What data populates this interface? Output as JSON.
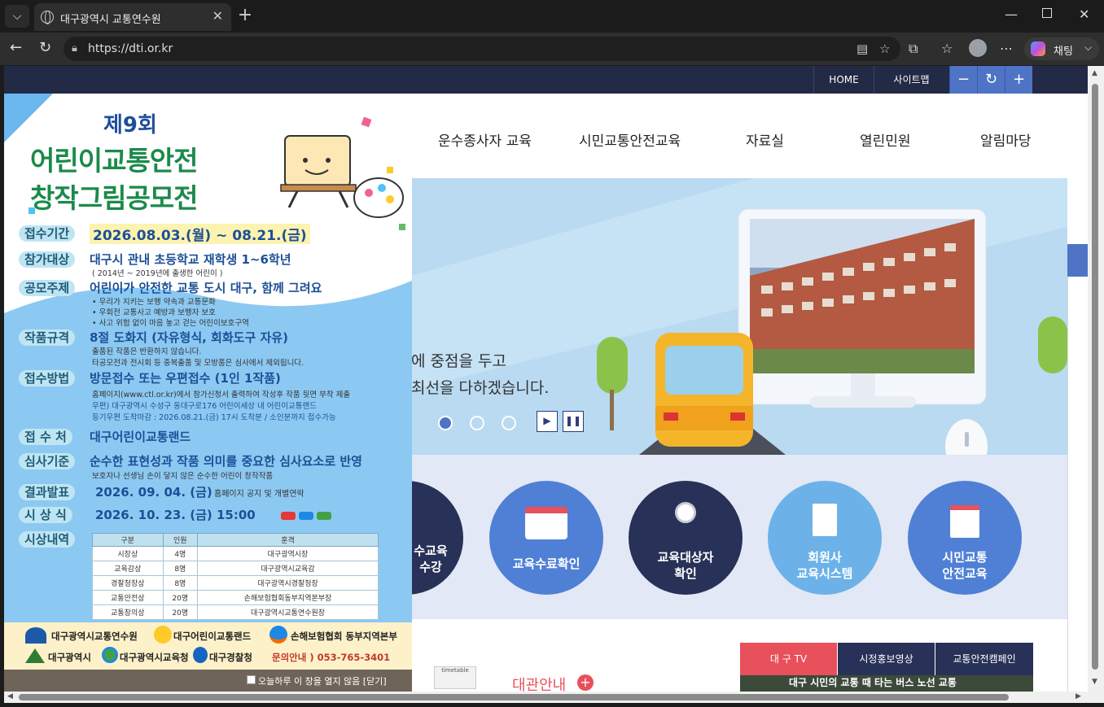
{
  "browser": {
    "tab_title": "대구광역시 교통연수원",
    "url": "https://dti.or.kr",
    "chat_label": "채팅",
    "icons": [
      "tab-list-icon",
      "globe-icon",
      "close-icon",
      "new-tab-icon",
      "minimize-icon",
      "maximize-icon",
      "window-close-icon",
      "back-icon",
      "refresh-icon",
      "lock-icon",
      "reader-icon",
      "favorite-star-icon",
      "extensions-icon",
      "favorites-icon",
      "profile-icon",
      "more-icon",
      "copilot-icon"
    ]
  },
  "topbar": {
    "home": "HOME",
    "sitemap": "사이트맵",
    "zoom_out": "−",
    "reset": "↻",
    "zoom_in": "+"
  },
  "main_nav": [
    "운수종사자 교육",
    "시민교통안전교육",
    "자료실",
    "열린민원",
    "알림마당"
  ],
  "hero": {
    "line1": "에 중점을 두고",
    "line2": "최선을 다하겠습니다.",
    "play": "▶",
    "pause": "❚❚"
  },
  "quick_links": [
    {
      "label1": "수교육",
      "label2": "수강"
    },
    {
      "label1": "교육수료확인",
      "label2": ""
    },
    {
      "label1": "교육대상자",
      "label2": "확인"
    },
    {
      "label1": "회원사",
      "label2": "교육시스템"
    },
    {
      "label1": "시민교통",
      "label2": "안전교육"
    }
  ],
  "guide": {
    "title": "대관안내",
    "badge": "timetable"
  },
  "tv_tabs": [
    "대 구  TV",
    "시정홍보영상",
    "교통안전캠페인"
  ],
  "tv_thumb_caption": "대구 시민의 교통 때 타는 버스 노선 교통",
  "popup": {
    "edition": "제9회",
    "title1": "어린이교통안전",
    "title2": "창작그림공모전",
    "rows": [
      {
        "label": "접수기간",
        "value": "2026.08.03.(월) ~ 08.21.(금)"
      },
      {
        "label": "참가대상",
        "value": "대구시 관내 초등학교 재학생 1~6학년",
        "note": "( 2014년 ~ 2019년에 출생한 어린이 )"
      },
      {
        "label": "공모주제",
        "value": "어린이가 안전한 교통 도시 대구, 함께 그려요",
        "bullets": [
          "우리가 지키는 보행 약속과 교통문화",
          "우회전 교통사고 예방과 보행자 보호",
          "사고 위험 없이 마음 놓고 걷는 어린이보호구역"
        ]
      },
      {
        "label": "작품규격",
        "value": "8절 도화지 (자유형식, 회화도구 자유)",
        "bullets": [
          "출품된 작품은 반환하지 않습니다.",
          "타공모전과 전시회 등 중복출품 및 모방품은 심사에서 제외됩니다."
        ]
      },
      {
        "label": "접수방법",
        "value": "방문접수 또는 우편접수 (1인 1작품)",
        "bullets": [
          "홈페이지(www.ctl.or.kr)에서 참가신청서 출력하여 작성후 작품 뒷면 부착 제출",
          "우편) 대구광역시 수성구 동대구로176 어린이세상 내 어린이교통랜드",
          "등기우편 도착마감 : 2026.08.21.(금) 17시 도착분 / 소인분까지 접수가능"
        ]
      },
      {
        "label": "접 수 처",
        "value": "대구어린이교통랜드"
      },
      {
        "label": "심사기준",
        "value": "순수한 표현성과 작품 의미를 중요한 심사요소로 반영",
        "note": "보호자나 선생님 손이 닿지 않은 순수한 어린이 창작작품"
      },
      {
        "label": "결과발표",
        "value": "2026. 09. 04. (금)",
        "note": "홈페이지 공지 및 개별연락"
      },
      {
        "label": "시 상 식",
        "value": "2026. 10. 23. (금) 15:00"
      },
      {
        "label": "시상내역",
        "value": ""
      }
    ],
    "table": {
      "headers": [
        "구분",
        "인원",
        "훈격"
      ],
      "rows": [
        [
          "시장상",
          "4명",
          "대구광역시장"
        ],
        [
          "교육감상",
          "8명",
          "대구광역시교육감"
        ],
        [
          "경찰청장상",
          "8명",
          "대구광역시경찰청장"
        ],
        [
          "교통안전상",
          "20명",
          "손해보험협회동부지역본부장"
        ],
        [
          "교통창의상",
          "20명",
          "대구광역시교통연수원장"
        ]
      ]
    },
    "sponsors": [
      "대구광역시교통연수원",
      "대구어린이교통랜드",
      "손해보험협회 동부지역본부",
      "대구광역시",
      "대구광역시교육청",
      "대구경찰청"
    ],
    "contact": "문의안내 ) 053-765-3401",
    "footer_text": "오늘하루 이 창을 열지 않음 [닫기]"
  },
  "colors": {
    "topbar": "#222a45",
    "accent_blue": "#4f74c6",
    "dark_navy": "#283157",
    "tv_active": "#e8505b"
  }
}
